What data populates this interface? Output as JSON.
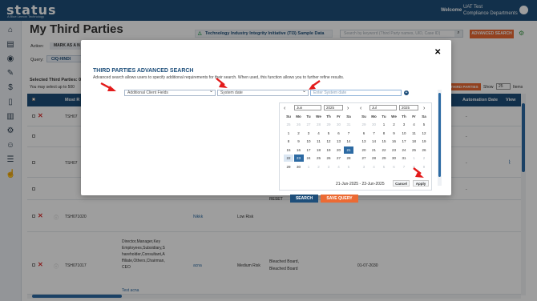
{
  "topbar": {
    "logo": "status",
    "logo_sub": "A Blue Lemon Technology",
    "welcome": "Welcome",
    "user_name": "UAT Test",
    "user_dept": "Compliance Departments"
  },
  "sidebar": {
    "icons": [
      "home-icon",
      "table-icon",
      "eye-icon",
      "document-icon",
      "dollar-icon",
      "doc-icon",
      "chart-icon",
      "gear-icon",
      "user-add-icon",
      "list-icon",
      "hand-icon"
    ]
  },
  "main": {
    "title": "My Third Parties",
    "tab_badge": "Technology Industry Integrity Initiative (TI3) Sample Data",
    "search_placeholder": "Search by keyword (Third Party names, UID, Case ID)",
    "advanced_search": "ADVANCED SEARCH",
    "action_label": "Action:",
    "action_value": "MARK AS A N",
    "query_label": "Query:",
    "query_value": "CIQ-HINDI",
    "selected_line": "Selected Third Parties: 0",
    "select_note": "You may select up to 500",
    "third_button": "THIRD PARTIES",
    "show_label": "Show",
    "show_value": "25",
    "items_label": "Items"
  },
  "table": {
    "header_left": "Most R",
    "header_right1": "Automation Date",
    "header_right2": "View",
    "rows": [
      {
        "id": "TSH07",
        "dash": "-"
      },
      {
        "id": "",
        "dash": "-"
      },
      {
        "id": "TSH07",
        "dash": "-"
      },
      {
        "id": "",
        "dash": "-"
      },
      {
        "id": "TSH071020",
        "name": "Nikkk",
        "risk": "Low Risk"
      },
      {
        "id": "TSH071017",
        "roles": "Director,Manager,Key Employees,Subsidiary,Shareholder,Consultant,Affiliate,Others,Chairman,CEO",
        "link": "Test acna",
        "name": "acna",
        "risk": "Medium Risk",
        "bleached": "Bleached Board, Bleached Board",
        "date": "01-07-2030"
      }
    ]
  },
  "modal": {
    "title": "THIRD PARTIES ADVANCED SEARCH",
    "description": "Advanced search allows users to specify additional requirements for their search. When used, this function allows you to further refine results.",
    "field1": "Additional Client Fields",
    "field2": "System date",
    "field3_placeholder": "Enter System date",
    "plus": "+",
    "reset": "RESET",
    "search": "SEARCH",
    "save_query": "SAVE QUERY"
  },
  "calendar": {
    "left_month": "Jun",
    "left_year": "2025",
    "right_month": "Jul",
    "right_year": "2025",
    "days_of_week": [
      "Su",
      "Mo",
      "Tu",
      "We",
      "Th",
      "Fr",
      "Sa"
    ],
    "left_days": [
      [
        "25",
        "26",
        "27",
        "28",
        "29",
        "30",
        "31"
      ],
      [
        "1",
        "2",
        "3",
        "4",
        "5",
        "6",
        "7"
      ],
      [
        "8",
        "9",
        "10",
        "11",
        "12",
        "13",
        "14"
      ],
      [
        "15",
        "16",
        "17",
        "18",
        "19",
        "20",
        "21"
      ],
      [
        "22",
        "23",
        "24",
        "25",
        "26",
        "27",
        "28"
      ],
      [
        "29",
        "30",
        "1",
        "2",
        "3",
        "4",
        "5"
      ]
    ],
    "right_days": [
      [
        "29",
        "30",
        "1",
        "2",
        "3",
        "4",
        "5"
      ],
      [
        "6",
        "7",
        "8",
        "9",
        "10",
        "11",
        "12"
      ],
      [
        "13",
        "14",
        "15",
        "16",
        "17",
        "18",
        "19"
      ],
      [
        "20",
        "21",
        "22",
        "23",
        "24",
        "25",
        "26"
      ],
      [
        "27",
        "28",
        "29",
        "30",
        "31",
        "1",
        "2"
      ],
      [
        "3",
        "4",
        "5",
        "6",
        "7",
        "8",
        "9"
      ]
    ],
    "range_text": "21-Jun-2025 - 23-Jun-2025",
    "cancel": "Cancel",
    "apply": "Apply"
  }
}
